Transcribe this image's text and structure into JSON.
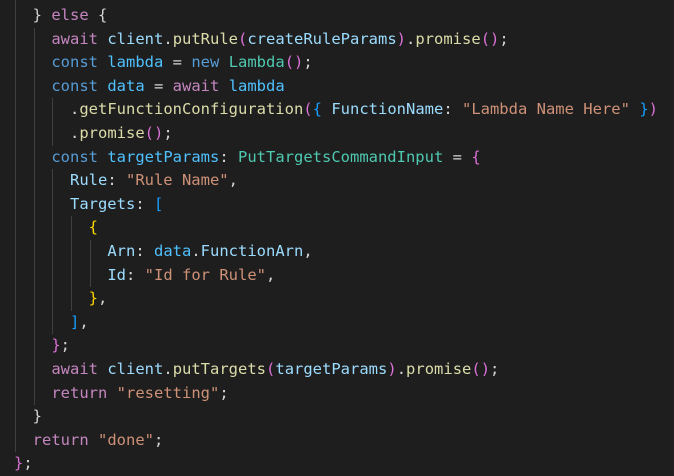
{
  "editor": {
    "language": "typescript",
    "theme": "dark",
    "colors": {
      "background": "#1e1e1e",
      "default": "#d4d4d4",
      "keyword": "#569cd6",
      "control": "#c586c0",
      "variable": "#9cdcfe",
      "constant": "#4fc1ff",
      "function": "#dcdcaa",
      "string": "#ce9178",
      "type": "#4ec9b0",
      "bracket_level1": "#ffd700",
      "bracket_level2": "#da70d6",
      "bracket_level3": "#179fff",
      "indent_guide": "#404040"
    },
    "lines": [
      {
        "indent": 2,
        "tokens": [
          {
            "t": "}",
            "c": "t-default"
          },
          {
            "t": " ",
            "c": "t-default"
          },
          {
            "t": "else",
            "c": "t-ctrl"
          },
          {
            "t": " {",
            "c": "t-default"
          }
        ]
      },
      {
        "indent": 4,
        "tokens": [
          {
            "t": "await",
            "c": "t-ctrl"
          },
          {
            "t": " ",
            "c": "t-default"
          },
          {
            "t": "client",
            "c": "t-var"
          },
          {
            "t": ".",
            "c": "t-default"
          },
          {
            "t": "putRule",
            "c": "t-fn"
          },
          {
            "t": "(",
            "c": "t-brk2"
          },
          {
            "t": "createRuleParams",
            "c": "t-var"
          },
          {
            "t": ")",
            "c": "t-brk2"
          },
          {
            "t": ".",
            "c": "t-default"
          },
          {
            "t": "promise",
            "c": "t-fn"
          },
          {
            "t": "()",
            "c": "t-brk2"
          },
          {
            "t": ";",
            "c": "t-default"
          }
        ]
      },
      {
        "indent": 4,
        "tokens": [
          {
            "t": "const",
            "c": "t-kw"
          },
          {
            "t": " ",
            "c": "t-default"
          },
          {
            "t": "lambda",
            "c": "t-const"
          },
          {
            "t": " = ",
            "c": "t-default"
          },
          {
            "t": "new",
            "c": "t-kw"
          },
          {
            "t": " ",
            "c": "t-default"
          },
          {
            "t": "Lambda",
            "c": "t-type"
          },
          {
            "t": "()",
            "c": "t-brk2"
          },
          {
            "t": ";",
            "c": "t-default"
          }
        ]
      },
      {
        "indent": 4,
        "tokens": [
          {
            "t": "const",
            "c": "t-kw"
          },
          {
            "t": " ",
            "c": "t-default"
          },
          {
            "t": "data",
            "c": "t-const"
          },
          {
            "t": " = ",
            "c": "t-default"
          },
          {
            "t": "await",
            "c": "t-ctrl"
          },
          {
            "t": " ",
            "c": "t-default"
          },
          {
            "t": "lambda",
            "c": "t-const"
          }
        ]
      },
      {
        "indent": 6,
        "tokens": [
          {
            "t": ".",
            "c": "t-default"
          },
          {
            "t": "getFunctionConfiguration",
            "c": "t-fn"
          },
          {
            "t": "(",
            "c": "t-brk2"
          },
          {
            "t": "{",
            "c": "t-brk3"
          },
          {
            "t": " ",
            "c": "t-default"
          },
          {
            "t": "FunctionName",
            "c": "t-var"
          },
          {
            "t": ": ",
            "c": "t-default"
          },
          {
            "t": "\"Lambda Name Here\"",
            "c": "t-str"
          },
          {
            "t": " ",
            "c": "t-default"
          },
          {
            "t": "}",
            "c": "t-brk3"
          },
          {
            "t": ")",
            "c": "t-brk2"
          }
        ]
      },
      {
        "indent": 6,
        "tokens": [
          {
            "t": ".",
            "c": "t-default"
          },
          {
            "t": "promise",
            "c": "t-fn"
          },
          {
            "t": "()",
            "c": "t-brk2"
          },
          {
            "t": ";",
            "c": "t-default"
          }
        ]
      },
      {
        "indent": 4,
        "tokens": [
          {
            "t": "const",
            "c": "t-kw"
          },
          {
            "t": " ",
            "c": "t-default"
          },
          {
            "t": "targetParams",
            "c": "t-const"
          },
          {
            "t": ": ",
            "c": "t-default"
          },
          {
            "t": "PutTargetsCommandInput",
            "c": "t-type"
          },
          {
            "t": " = ",
            "c": "t-default"
          },
          {
            "t": "{",
            "c": "t-brk2"
          }
        ]
      },
      {
        "indent": 6,
        "tokens": [
          {
            "t": "Rule",
            "c": "t-var"
          },
          {
            "t": ": ",
            "c": "t-default"
          },
          {
            "t": "\"Rule Name\"",
            "c": "t-str"
          },
          {
            "t": ",",
            "c": "t-default"
          }
        ]
      },
      {
        "indent": 6,
        "tokens": [
          {
            "t": "Targets",
            "c": "t-var"
          },
          {
            "t": ": ",
            "c": "t-default"
          },
          {
            "t": "[",
            "c": "t-brk3"
          }
        ]
      },
      {
        "indent": 8,
        "tokens": [
          {
            "t": "{",
            "c": "t-brk1"
          }
        ]
      },
      {
        "indent": 10,
        "tokens": [
          {
            "t": "Arn",
            "c": "t-var"
          },
          {
            "t": ": ",
            "c": "t-default"
          },
          {
            "t": "data",
            "c": "t-const"
          },
          {
            "t": ".",
            "c": "t-default"
          },
          {
            "t": "FunctionArn",
            "c": "t-var"
          },
          {
            "t": ",",
            "c": "t-default"
          }
        ]
      },
      {
        "indent": 10,
        "tokens": [
          {
            "t": "Id",
            "c": "t-var"
          },
          {
            "t": ": ",
            "c": "t-default"
          },
          {
            "t": "\"Id for Rule\"",
            "c": "t-str"
          },
          {
            "t": ",",
            "c": "t-default"
          }
        ]
      },
      {
        "indent": 8,
        "tokens": [
          {
            "t": "}",
            "c": "t-brk1"
          },
          {
            "t": ",",
            "c": "t-default"
          }
        ]
      },
      {
        "indent": 6,
        "tokens": [
          {
            "t": "]",
            "c": "t-brk3"
          },
          {
            "t": ",",
            "c": "t-default"
          }
        ]
      },
      {
        "indent": 4,
        "tokens": [
          {
            "t": "}",
            "c": "t-brk2"
          },
          {
            "t": ";",
            "c": "t-default"
          }
        ]
      },
      {
        "indent": 4,
        "tokens": [
          {
            "t": "await",
            "c": "t-ctrl"
          },
          {
            "t": " ",
            "c": "t-default"
          },
          {
            "t": "client",
            "c": "t-var"
          },
          {
            "t": ".",
            "c": "t-default"
          },
          {
            "t": "putTargets",
            "c": "t-fn"
          },
          {
            "t": "(",
            "c": "t-brk2"
          },
          {
            "t": "targetParams",
            "c": "t-var"
          },
          {
            "t": ")",
            "c": "t-brk2"
          },
          {
            "t": ".",
            "c": "t-default"
          },
          {
            "t": "promise",
            "c": "t-fn"
          },
          {
            "t": "()",
            "c": "t-brk2"
          },
          {
            "t": ";",
            "c": "t-default"
          }
        ]
      },
      {
        "indent": 4,
        "tokens": [
          {
            "t": "return",
            "c": "t-ctrl"
          },
          {
            "t": " ",
            "c": "t-default"
          },
          {
            "t": "\"resetting\"",
            "c": "t-str"
          },
          {
            "t": ";",
            "c": "t-default"
          }
        ]
      },
      {
        "indent": 2,
        "tokens": [
          {
            "t": "}",
            "c": "t-default"
          }
        ]
      },
      {
        "indent": 2,
        "tokens": [
          {
            "t": "return",
            "c": "t-ctrl"
          },
          {
            "t": " ",
            "c": "t-default"
          },
          {
            "t": "\"done\"",
            "c": "t-str"
          },
          {
            "t": ";",
            "c": "t-default"
          }
        ]
      },
      {
        "indent": 0,
        "tokens": [
          {
            "t": "}",
            "c": "t-brk2"
          },
          {
            "t": ";",
            "c": "t-default"
          }
        ]
      }
    ]
  }
}
